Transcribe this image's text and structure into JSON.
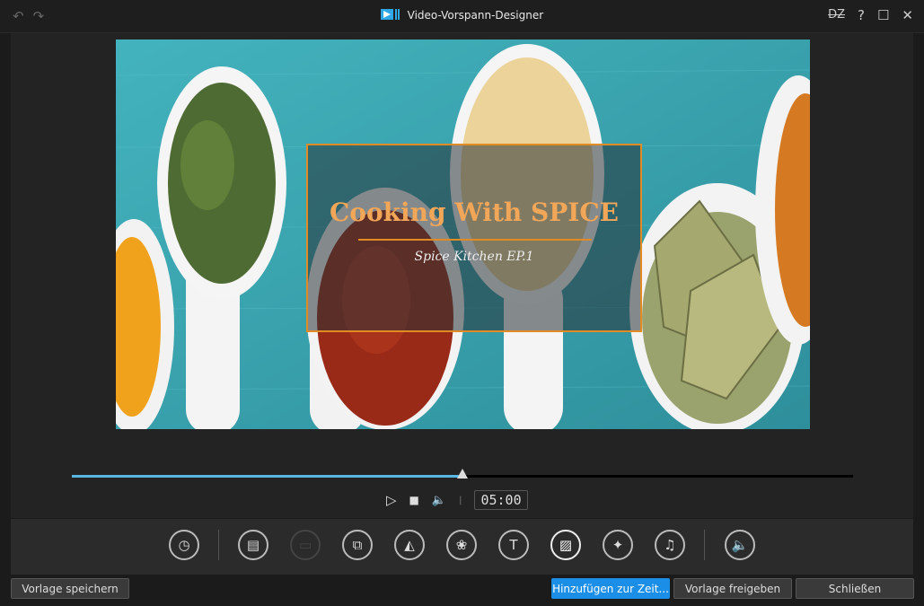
{
  "window": {
    "title": "Video-Vorspann-Designer",
    "undo_icon": "undo-icon",
    "redo_icon": "redo-icon",
    "controls": [
      {
        "name": "dz-icon",
        "glyph": "DZ"
      },
      {
        "name": "help-icon",
        "glyph": "?"
      },
      {
        "name": "maximize-icon",
        "glyph": "☐"
      },
      {
        "name": "close-icon",
        "glyph": "✕"
      }
    ]
  },
  "preview": {
    "title_text": "Cooking With SPICE",
    "subtitle_text": "Spice Kitchen EP.1",
    "accent_color": "#e08b24"
  },
  "playback": {
    "progress": 0.5,
    "time": "05:00",
    "play_icon": "▷",
    "stop_icon": "■",
    "volume_icon": "🔈"
  },
  "tools": [
    {
      "name": "duration-tool",
      "glyph": "◷",
      "state": "normal"
    },
    {
      "name": "transition-tool",
      "glyph": "▤",
      "state": "normal"
    },
    {
      "name": "background-tool",
      "glyph": "▭",
      "state": "disabled"
    },
    {
      "name": "crop-tool",
      "glyph": "⧉",
      "state": "normal"
    },
    {
      "name": "flip-tool",
      "glyph": "◭",
      "state": "normal"
    },
    {
      "name": "effects-tool",
      "glyph": "❀",
      "state": "normal"
    },
    {
      "name": "text-tool",
      "glyph": "T",
      "state": "normal"
    },
    {
      "name": "image-tool",
      "glyph": "▨",
      "state": "active"
    },
    {
      "name": "particle-tool",
      "glyph": "✦",
      "state": "normal"
    },
    {
      "name": "music-tool",
      "glyph": "♫",
      "state": "normal"
    },
    {
      "name": "audio-tool",
      "glyph": "🔈",
      "state": "normal"
    }
  ],
  "buttons": {
    "save_template": "Vorlage speichern",
    "add_timeline": "Hinzufügen zur Zeit...",
    "share_template": "Vorlage freigeben",
    "close": "Schließen"
  }
}
